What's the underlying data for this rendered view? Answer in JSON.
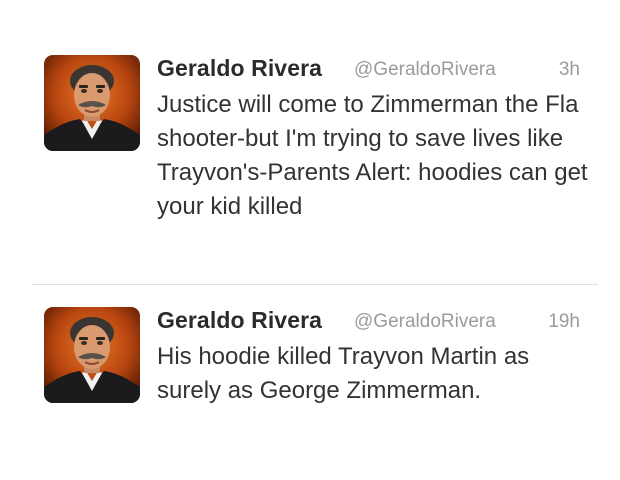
{
  "tweets": [
    {
      "author_name": "Geraldo Rivera",
      "handle": "@GeraldoRivera",
      "time": "3h",
      "text": "Justice will come to Zimmerman the Fla shooter-but I'm trying to save lives like Trayvon's-Parents Alert: hoodies can get your kid killed",
      "avatar_icon": "profile-photo"
    },
    {
      "author_name": "Geraldo Rivera",
      "handle": "@GeraldoRivera",
      "time": "19h",
      "text": "His hoodie killed Trayvon Martin as surely as George Zimmerman.",
      "avatar_icon": "profile-photo"
    }
  ],
  "colors": {
    "name": "#2b2b2b",
    "meta": "#9b9b9b",
    "text": "#333333",
    "divider": "#e2e2e2",
    "avatar_background": "#b8460f"
  }
}
